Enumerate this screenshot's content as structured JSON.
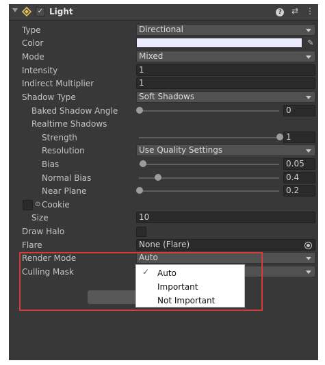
{
  "header": {
    "title": "Light",
    "enabled_check": "✓",
    "help_icon": "?",
    "preset_icon": "⇄",
    "menu_icon": "⋮"
  },
  "properties": {
    "type": {
      "label": "Type",
      "value": "Directional"
    },
    "color": {
      "label": "Color",
      "value": "#ebebff"
    },
    "mode": {
      "label": "Mode",
      "value": "Mixed"
    },
    "intensity": {
      "label": "Intensity",
      "value": "1"
    },
    "indirect_multiplier": {
      "label": "Indirect Multiplier",
      "value": "1"
    },
    "shadow_type": {
      "label": "Shadow Type",
      "value": "Soft Shadows"
    },
    "baked_shadow_angle": {
      "label": "Baked Shadow Angle",
      "value": "0",
      "fraction": 0.0
    },
    "realtime_shadows": {
      "label": "Realtime Shadows"
    },
    "strength": {
      "label": "Strength",
      "value": "1",
      "fraction": 1.0
    },
    "resolution": {
      "label": "Resolution",
      "value": "Use Quality Settings"
    },
    "bias": {
      "label": "Bias",
      "value": "0.05",
      "fraction": 0.025
    },
    "normal_bias": {
      "label": "Normal Bias",
      "value": "0.4",
      "fraction": 0.13
    },
    "near_plane": {
      "label": "Near Plane",
      "value": "0.2",
      "fraction": 0.0
    },
    "cookie": {
      "label": "Cookie",
      "icon": "⊙"
    },
    "size": {
      "label": "Size",
      "value": "10"
    },
    "draw_halo": {
      "label": "Draw Halo",
      "checked": false
    },
    "flare": {
      "label": "Flare",
      "value": "None (Flare)"
    },
    "render_mode": {
      "label": "Render Mode",
      "value": "Auto"
    },
    "culling_mask": {
      "label": "Culling Mask"
    }
  },
  "render_mode_menu": {
    "items": [
      {
        "label": "Auto",
        "selected": true,
        "check": "✓"
      },
      {
        "label": "Important",
        "selected": false,
        "check": ""
      },
      {
        "label": "Not Important",
        "selected": false,
        "check": ""
      }
    ]
  },
  "colors": {
    "panel": "#383838",
    "highlight": "#d63b3b",
    "menu_bg": "#ffffff"
  }
}
